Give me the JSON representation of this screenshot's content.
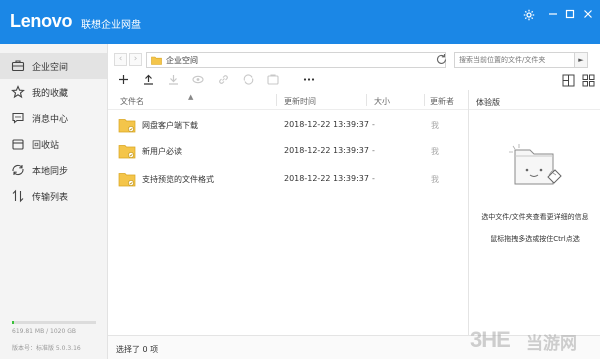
{
  "titlebar": {
    "brand": "Lenovo",
    "subtitle": "联想企业网盘",
    "accent_color": "#1b87e6",
    "settings_icon": "gear-icon",
    "minimize_icon": "minimize-icon",
    "maximize_icon": "maximize-icon",
    "close_icon": "close-icon"
  },
  "sidebar": {
    "items": [
      {
        "label": "企业空间",
        "icon": "briefcase-icon",
        "active": true
      },
      {
        "label": "我的收藏",
        "icon": "star-icon",
        "active": false
      },
      {
        "label": "消息中心",
        "icon": "message-icon",
        "active": false
      },
      {
        "label": "回收站",
        "icon": "trash-icon",
        "active": false
      },
      {
        "label": "本地同步",
        "icon": "sync-icon",
        "active": false
      },
      {
        "label": "传输列表",
        "icon": "transfer-icon",
        "active": false
      }
    ],
    "storage": {
      "text": "619.81 MB / 1020 GB",
      "used_fraction": 0.006,
      "bar_color": "#3ac13a"
    },
    "version": "版本号：标准版  5.0.3.16"
  },
  "addressbar": {
    "path": "企业空间",
    "search_placeholder": "搜索当前位置的文件/文件夹"
  },
  "toolbar": {
    "buttons": [
      "new-icon",
      "upload-icon",
      "download-icon",
      "preview-icon",
      "link-icon",
      "sync-icon",
      "share-icon",
      "more-icon"
    ],
    "view_buttons": [
      "list-view-icon",
      "grid-view-icon"
    ]
  },
  "filelist": {
    "columns": [
      "文件名",
      "更新时间",
      "大小",
      "更新者"
    ],
    "rows": [
      {
        "name": "网盘客户端下载",
        "date": "2018-12-22 13:39:37",
        "size": "-",
        "owner": "我"
      },
      {
        "name": "新用户必读",
        "date": "2018-12-22 13:39:37",
        "size": "-",
        "owner": "我"
      },
      {
        "name": "支持预览的文件格式",
        "date": "2018-12-22 13:39:37",
        "size": "-",
        "owner": "我"
      }
    ]
  },
  "detail": {
    "title": "体验版",
    "message1": "选中文件/文件夹查看更详细的信息",
    "message2": "鼠标拖拽多选或按住Ctrl点选"
  },
  "statusbar": {
    "text": "选择了 0 项"
  },
  "watermark": {
    "mark": "3HE",
    "text": "当游网"
  }
}
